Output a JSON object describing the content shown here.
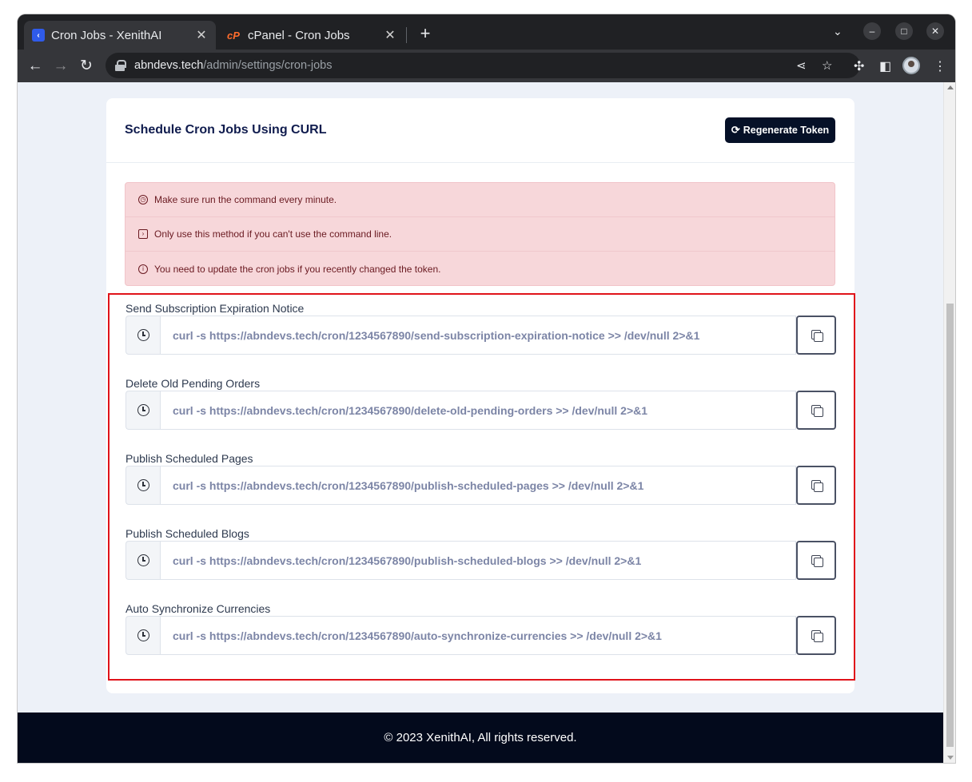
{
  "browser": {
    "tabs": [
      {
        "title": "Cron Jobs - XenithAI",
        "favicon": "xenithai-favicon",
        "active": true
      },
      {
        "title": "cPanel - Cron Jobs",
        "favicon": "cpanel-favicon",
        "active": false
      }
    ],
    "url_host": "abndevs.tech",
    "url_path": "/admin/settings/cron-jobs"
  },
  "page": {
    "card_title": "Schedule Cron Jobs Using CURL",
    "regenerate_label": "Regenerate Token",
    "notices": [
      {
        "icon": "clock-icon",
        "text": "Make sure run the command every minute."
      },
      {
        "icon": "terminal-icon",
        "text": "Only use this method if you can't use the command line."
      },
      {
        "icon": "info-icon",
        "text": "You need to update the cron jobs if you recently changed the token."
      }
    ],
    "jobs": [
      {
        "label": "Send Subscription Expiration Notice",
        "command": "curl -s https://abndevs.tech/cron/1234567890/send-subscription-expiration-notice >> /dev/null 2>&1"
      },
      {
        "label": "Delete Old Pending Orders",
        "command": "curl -s https://abndevs.tech/cron/1234567890/delete-old-pending-orders >> /dev/null 2>&1"
      },
      {
        "label": "Publish Scheduled Pages",
        "command": "curl -s https://abndevs.tech/cron/1234567890/publish-scheduled-pages >> /dev/null 2>&1"
      },
      {
        "label": "Publish Scheduled Blogs",
        "command": "curl -s https://abndevs.tech/cron/1234567890/publish-scheduled-blogs >> /dev/null 2>&1"
      },
      {
        "label": "Auto Synchronize Currencies",
        "command": "curl -s https://abndevs.tech/cron/1234567890/auto-synchronize-currencies >> /dev/null 2>&1"
      }
    ],
    "footer": "© 2023 XenithAI, All rights reserved."
  },
  "colors": {
    "highlight_border": "#e0131a",
    "alert_bg": "#f7d7da",
    "button_bg": "#051027",
    "footer_bg": "#030a1c"
  }
}
